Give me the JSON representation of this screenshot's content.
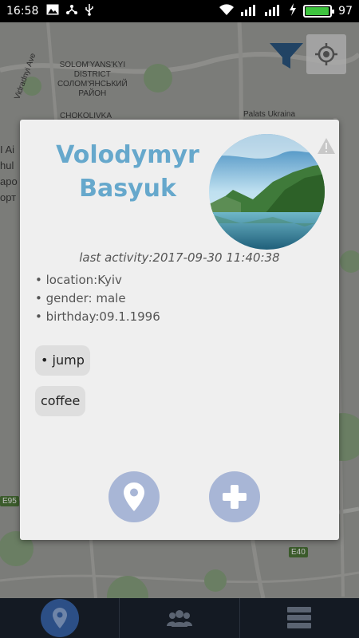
{
  "status_bar": {
    "time": "16:58",
    "battery_percent": "97",
    "battery_level": 0.97,
    "icons": [
      "image-icon",
      "usb-share-icon",
      "usb-icon",
      "wifi-icon",
      "signal-3g-icon",
      "signal-icon",
      "charging-icon"
    ]
  },
  "map": {
    "labels": {
      "district_1": "SOLOM'YANS'KYI",
      "district_2": "DISTRICT",
      "district_3": "СОЛОМ'ЯНСЬКИЙ",
      "district_4": "РАЙОН",
      "chokolivka": "CHOKOLIVKA",
      "palats": "Palats Ukraina",
      "vidradnyi": "Vidradnyi Ave",
      "left_1": "I Ai",
      "left_2": "hul",
      "left_3": "аро",
      "left_4": "орт",
      "road_e95": "E95",
      "road_e40": "E40"
    }
  },
  "profile": {
    "name": "Volodymyr Basyuk",
    "last_activity": "last activity:2017-09-30 11:40:38",
    "location": "location:Kyiv",
    "gender": "gender: male",
    "birthday": "birthday:09.1.1996",
    "tags": [
      "jump",
      "coffee"
    ]
  },
  "buttons": {
    "show_on_map_icon": "map-pin-icon",
    "add_friend_icon": "plus-icon"
  },
  "bottom_nav": {
    "items": [
      "map-pin-icon",
      "people-icon",
      "list-icon"
    ],
    "active": 0
  },
  "colors": {
    "name": "#66a8cc",
    "action_button": "#a8b6d6",
    "bottom_bar": "#141a23",
    "active_nav": "#2c4f86",
    "filter": "#2c5a86"
  }
}
